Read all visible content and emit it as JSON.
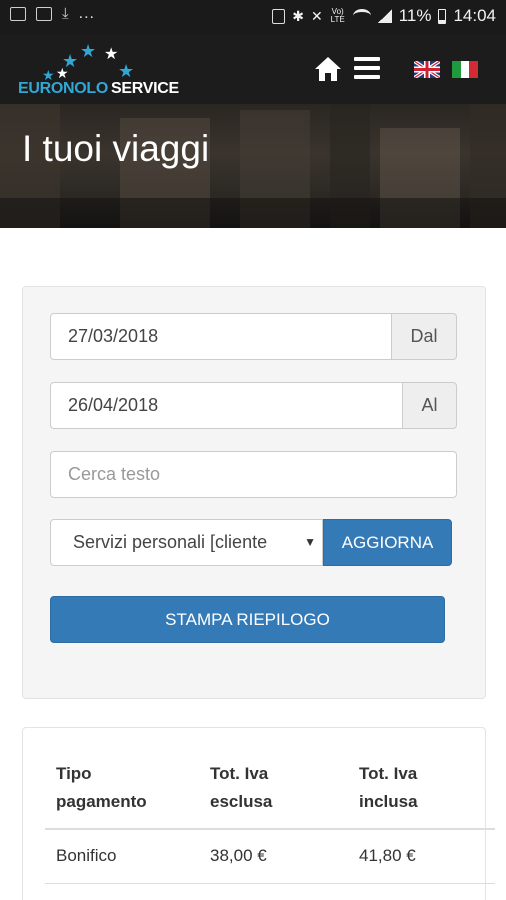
{
  "status_bar": {
    "battery": "11%",
    "time": "14:04",
    "network_label": "Vo) LTE",
    "left_overflow": "..."
  },
  "header": {
    "logo": {
      "word1": "EURONOLO",
      "word2": "SERVICE",
      "star_color": "#31a7d6"
    },
    "icons": [
      "home-icon",
      "menu-icon",
      "flag-uk-icon",
      "flag-it-icon"
    ]
  },
  "hero": {
    "title": "I tuoi viaggi"
  },
  "filters": {
    "date_from": {
      "value": "27/03/2018",
      "addon": "Dal"
    },
    "date_to": {
      "value": "26/04/2018",
      "addon": "Al"
    },
    "search": {
      "placeholder": "Cerca testo"
    },
    "select": {
      "selected": "Servizi personali [cliente"
    },
    "update_button": "AGGIORNA",
    "print_button": "STAMPA RIEPILOGO"
  },
  "summary_table": {
    "headers": [
      {
        "line1": "Tipo",
        "line2": "pagamento"
      },
      {
        "line1": "Tot. Iva",
        "line2": "esclusa"
      },
      {
        "line1": "Tot. Iva",
        "line2": "inclusa"
      }
    ],
    "rows": [
      [
        "Bonifico",
        "38,00 €",
        "41,80 €"
      ]
    ]
  },
  "colors": {
    "primary": "#337ab7",
    "header_bg": "#1c1c1c",
    "logo_blue": "#31a7d6"
  }
}
